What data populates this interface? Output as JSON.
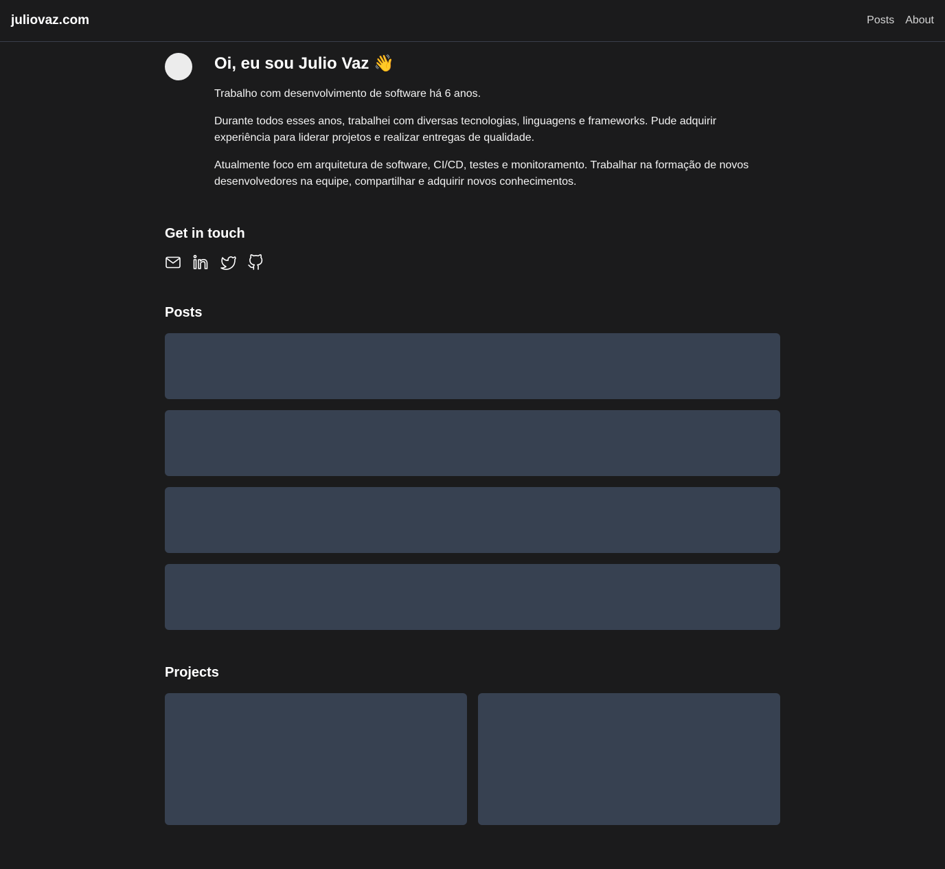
{
  "nav": {
    "brand": "juliovaz.com",
    "links": [
      "Posts",
      "About"
    ]
  },
  "intro": {
    "title": "Oi, eu sou Julio Vaz 👋",
    "paragraphs": [
      "Trabalho com desenvolvimento de software há 6 anos.",
      "Durante todos esses anos, trabalhei com diversas tecnologias, linguagens e frameworks. Pude adquirir experiência para liderar projetos e realizar entregas de qualidade.",
      "Atualmente foco em arquitetura de software, CI/CD, testes e monitoramento. Trabalhar na formação de novos desenvolvedores na equipe, compartilhar e adquirir novos conhecimentos."
    ]
  },
  "contact": {
    "title": "Get in touch",
    "icons": [
      "mail-icon",
      "linkedin-icon",
      "twitter-icon",
      "github-icon"
    ]
  },
  "posts": {
    "title": "Posts",
    "count": 4
  },
  "projects": {
    "title": "Projects",
    "count": 2
  },
  "colors": {
    "background": "#1b1b1c",
    "card": "#374151",
    "avatar": "#ececec",
    "border": "#3a3f4b"
  }
}
